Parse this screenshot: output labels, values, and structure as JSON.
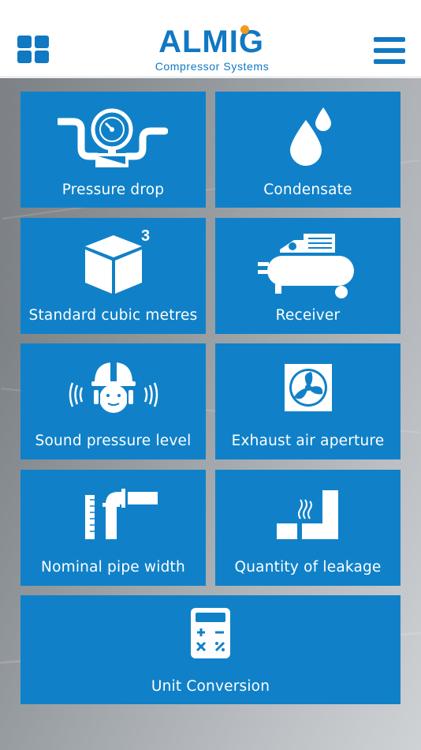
{
  "header": {
    "logo_text": "ALMIG",
    "logo_subtitle": "Compressor Systems",
    "logo_dot_color": "#f29a1d",
    "brand_color": "#1178c2",
    "grid_icon": "grid-icon",
    "menu_icon": "hamburger-menu-icon"
  },
  "tiles": [
    {
      "label": "Pressure drop",
      "icon": "pressure-gauge-pipe-icon"
    },
    {
      "label": "Condensate",
      "icon": "water-drops-icon"
    },
    {
      "label": "Standard cubic metres",
      "icon": "cube-icon",
      "superscript": "3"
    },
    {
      "label": "Receiver",
      "icon": "air-compressor-icon"
    },
    {
      "label": "Sound pressure level",
      "icon": "worker-ear-protection-icon"
    },
    {
      "label": "Exhaust air aperture",
      "icon": "exhaust-fan-icon"
    },
    {
      "label": "Nominal pipe width",
      "icon": "pipe-ruler-icon"
    },
    {
      "label": "Quantity of leakage",
      "icon": "leaking-pipe-icon"
    },
    {
      "label": "Unit Conversion",
      "icon": "calculator-icon"
    }
  ],
  "tile_color": "#1081c8"
}
